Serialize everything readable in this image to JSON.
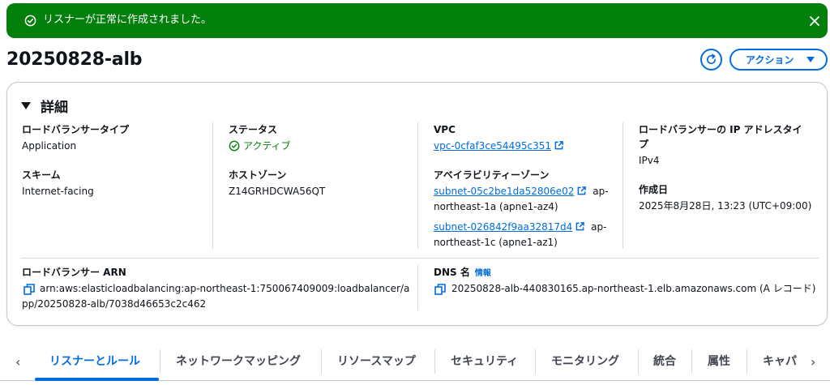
{
  "flash": {
    "message": "リスナーが正常に作成されました。",
    "color": "#037f0c"
  },
  "header": {
    "title": "20250828-alb",
    "action_label": "アクション"
  },
  "details": {
    "section_title": "詳細",
    "lb_type_label": "ロードバランサータイプ",
    "lb_type_value": "Application",
    "scheme_label": "スキーム",
    "scheme_value": "Internet-facing",
    "status_label": "ステータス",
    "status_value": "アクティブ",
    "hosted_zone_label": "ホストゾーン",
    "hosted_zone_value": "Z14GRHDCWA56QT",
    "vpc_label": "VPC",
    "vpc_value": "vpc-0cfaf3ce54495c351",
    "az_label": "アベイラビリティーゾーン",
    "subnets": [
      {
        "id": "subnet-05c2be1da52806e02",
        "suffix_line1": "ap-",
        "line2": "northeast-1a (apne1-az4)"
      },
      {
        "id": "subnet-026842f9aa32817d4",
        "suffix_line1": "ap-",
        "line2": "northeast-1c (apne1-az1)"
      }
    ],
    "ip_type_label_line1": "ロードバランサーの IP アドレスタイ",
    "ip_type_label_line2": "プ",
    "ip_type_value": "IPv4",
    "created_label": "作成日",
    "created_value": "2025年8月28日, 13:23 (UTC+09:00)",
    "arn_label": "ロードバランサー ARN",
    "arn_line1": "arn:aws:elasticloadbalancing:ap-northeast-1:750067409009:loadbalancer/a",
    "arn_line2": "pp/20250828-alb/7038d46653c2c462",
    "dns_label": "DNS 名",
    "dns_info": "情報",
    "dns_value": "20250828-alb-440830165.ap-northeast-1.elb.amazonaws.com (A レコード)"
  },
  "tabs": {
    "items": [
      "リスナーとルール",
      "ネットワークマッピング",
      "リソースマップ",
      "セキュリティ",
      "モニタリング",
      "統合",
      "属性",
      "キャパ"
    ],
    "active_index": 0
  },
  "colors": {
    "accent": "#006ce0",
    "success": "#037f0c",
    "divider": "#d5dbdb"
  }
}
